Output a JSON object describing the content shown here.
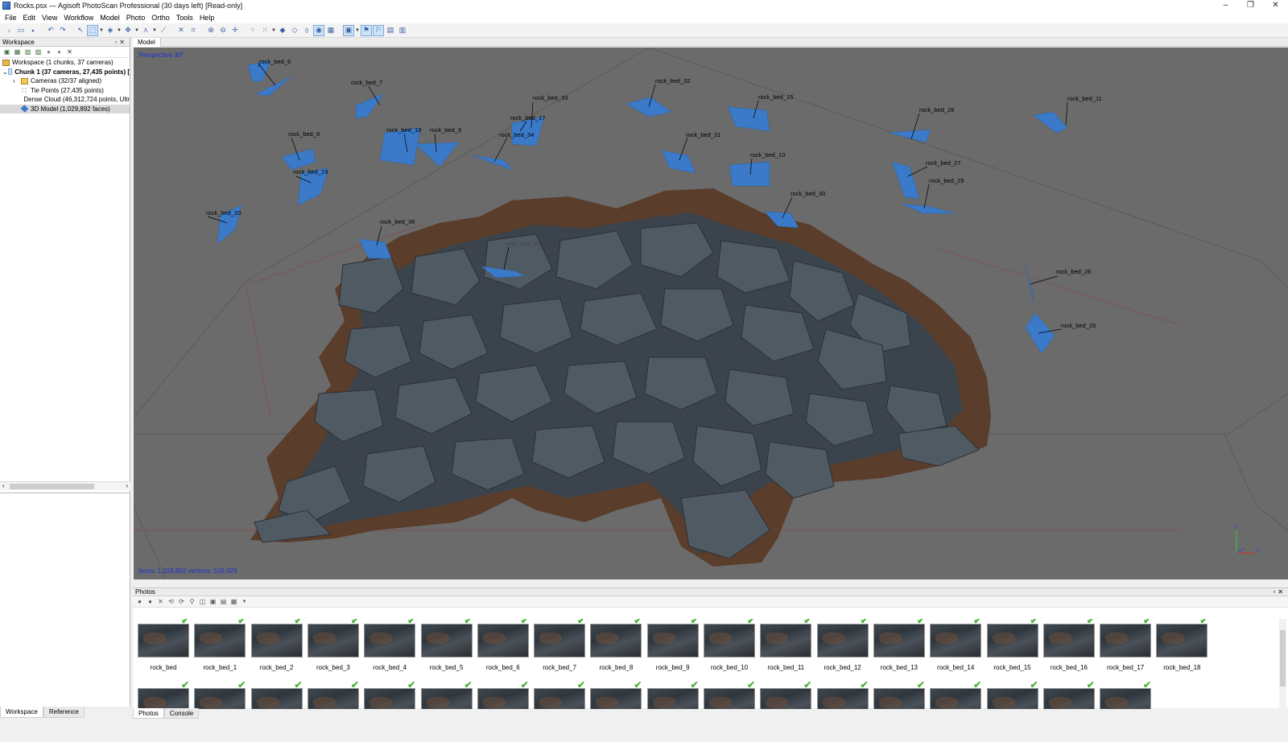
{
  "window": {
    "title": "Rocks.psx — Agisoft PhotoScan Professional (30 days left) [Read-only]",
    "controls": [
      "–",
      "❐",
      "✕"
    ]
  },
  "menu": [
    "File",
    "Edit",
    "View",
    "Workflow",
    "Model",
    "Photo",
    "Ortho",
    "Tools",
    "Help"
  ],
  "workspace": {
    "panel_title": "Workspace",
    "tree": [
      {
        "label": "Workspace (1 chunks, 37 cameras)",
        "icon": "workspace-icon",
        "bold": false
      },
      {
        "label": "Chunk 1 (37 cameras, 27,435 points) [",
        "icon": "chunk-icon",
        "bold": true
      },
      {
        "label": "Cameras (32/37 aligned)",
        "icon": "folder-icon",
        "bold": false
      },
      {
        "label": "Tie Points (27,435 points)",
        "icon": "tie-points-icon",
        "bold": false
      },
      {
        "label": "Dense Cloud (46,312,724 points, Ultr",
        "icon": "dense-cloud-icon",
        "bold": false
      },
      {
        "label": "3D Model (1,029,892 faces)",
        "icon": "mesh-icon",
        "bold": false
      }
    ],
    "tabs": [
      "Workspace",
      "Reference"
    ]
  },
  "model": {
    "tab_label": "Model",
    "projection": "Perspective 30°",
    "faces_info": "faces: 1,029,892 vertices: 518,629",
    "cameras": [
      "rock_bed_6",
      "rock_bed_7",
      "rock_bed_32",
      "rock_bed_33",
      "rock_bed_15",
      "rock_bed_11",
      "rock_bed_17",
      "rock_bed_28",
      "rock_bed_18",
      "rock_bed_9",
      "rock_bed_34",
      "rock_bed_31",
      "rock_bed_8",
      "rock_bed_10",
      "rock_bed_27",
      "rock_bed_19",
      "rock_bed_29",
      "rock_bed_30",
      "rock_bed_20",
      "rock_bed_36",
      "rock_bed_35",
      "rock_bed_26",
      "rock_bed_25"
    ],
    "axis_labels": {
      "y": "Y",
      "x": "X"
    }
  },
  "photos": {
    "panel_title": "Photos",
    "items": [
      "rock_bed",
      "rock_bed_1",
      "rock_bed_2",
      "rock_bed_3",
      "rock_bed_4",
      "rock_bed_5",
      "rock_bed_6",
      "rock_bed_7",
      "rock_bed_8",
      "rock_bed_9",
      "rock_bed_10",
      "rock_bed_11",
      "rock_bed_12",
      "rock_bed_13",
      "rock_bed_14",
      "rock_bed_15",
      "rock_bed_16",
      "rock_bed_17",
      "rock_bed_18"
    ],
    "tabs": [
      "Photos",
      "Console"
    ]
  },
  "colors": {
    "viewport_bg": "#6b6b6b",
    "camera_plane": "#3a7ac8",
    "hud_text": "#1d2fd0",
    "aligned_check": "#4bb43a"
  }
}
